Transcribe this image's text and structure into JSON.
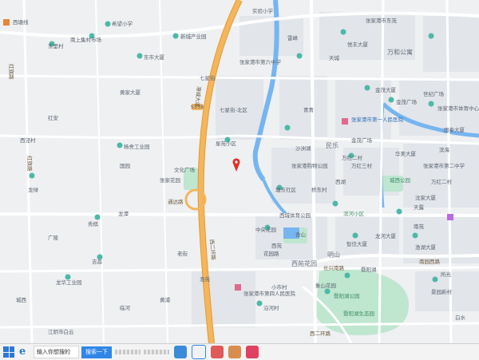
{
  "map": {
    "colors": {
      "background": "#eef0f2",
      "block": "#e2e5ea",
      "road": "#ffffff",
      "highway": "#f4b65c",
      "highway_stroke": "#e39a33",
      "water": "#76b5f0",
      "park": "#bfe6cf",
      "marker": "#e0302b"
    },
    "icons": [
      "poi-pin-icon",
      "location-marker-icon",
      "hospital-icon",
      "school-icon"
    ],
    "labels": {
      "west_railway": "西塘线",
      "west_school": "希望小学",
      "shangji_village": "南上集村市场",
      "dongli": "东里村",
      "dongshi": "东市大厦",
      "xinwei": "新城产业园",
      "shiyan": "实验小学",
      "mid_school": "张家港市第六中学",
      "leicheng": "雷峰",
      "tiancheng": "天城",
      "aodi": "张家港市东苑",
      "qiaoxing": "悦丰大厦",
      "wanhe": "万和公寓",
      "jinyuan": "金茂大厦",
      "jinmao": "金茂广场",
      "shiji": "世纪广场",
      "zhaojia": "张家港市体育中心",
      "guotai": "国泰大厦",
      "qixing": "七星街",
      "qixing_district": "七星街-北区",
      "xingyuan": "星苑小区",
      "first_hospital": "张家港市第一人民医院",
      "wanhong": "万红二村",
      "wanhong2": "万红二村",
      "wanhong3": "万红三村",
      "minle": "民乐",
      "shopping": "张家港购物公园",
      "yumin": "沙洲湖",
      "huamei": "华美大厦",
      "second_mid": "张家港市第二中学",
      "chengshi": "城西公园",
      "xijing": "西泾村",
      "industry_park": "杨舍工业园",
      "cultural_plaza": "文化广场",
      "zhangjia_garden": "张家花园",
      "longlv": "龙绿",
      "guoyuan": "国园",
      "huangjia": "黄家大厦",
      "tongchang": "塘东社区",
      "qiaodong": "桥东村",
      "xihu": "西湖",
      "qingqing": "青青",
      "riverside": "滨河小区",
      "tiyu": "西城体育公园",
      "zhongguo_garden": "中央花园",
      "xiyuan": "西苑",
      "xiang": "香山",
      "nanyuan": "南苑",
      "xiyuan_garden": "西苑花园",
      "mingshan": "明山",
      "yangshe": "暨阳湖",
      "zhixin": "智信大厦",
      "longhe": "龙河大厦",
      "yuhe": "渔湖大厦",
      "binhai": "滨海",
      "changxing": "长兴南路",
      "tianlu": "天露",
      "nanyuan_road": "南园西路",
      "jingyuan": "景园新村",
      "suoxian": "所光",
      "xiangshan": "象山花园",
      "yanhe": "沿河村",
      "xiaoshi": "小市村",
      "tongda": "通达路",
      "baishui": "白水",
      "shenyang": "沈家大厦",
      "hospital4": "张家港市第四人民医院",
      "laojie": "老街",
      "yuyuan": "渔苑",
      "lakepark": "暨阳湖生态园",
      "yangshe_lake": "暨阳湖公园",
      "huangpu": "黄浦",
      "linhe": "临河",
      "jichang": "吉昌",
      "xiuqi": "秀棋",
      "longjie": "龙潭",
      "longhua": "龙华工业园",
      "jiangyin": "江阴市白云",
      "hongji": "红旗路",
      "huangjiali": "花园路",
      "cheng_west": "城西",
      "hongqi": "红旗路",
      "guangling": "广陵",
      "hongan": "红安",
      "road_gaoxin": "港城大道",
      "road_east": "西二环路",
      "road_south": "西二环路"
    },
    "highway_badge": "S338"
  },
  "taskbar": {
    "search_placeholder": "输入你想搜的",
    "search_button": "搜索一下",
    "apps": [
      "browser-app-icon",
      "sogou-app-icon",
      "media-app-icon",
      "photo-app-icon",
      "store-app-icon"
    ]
  }
}
